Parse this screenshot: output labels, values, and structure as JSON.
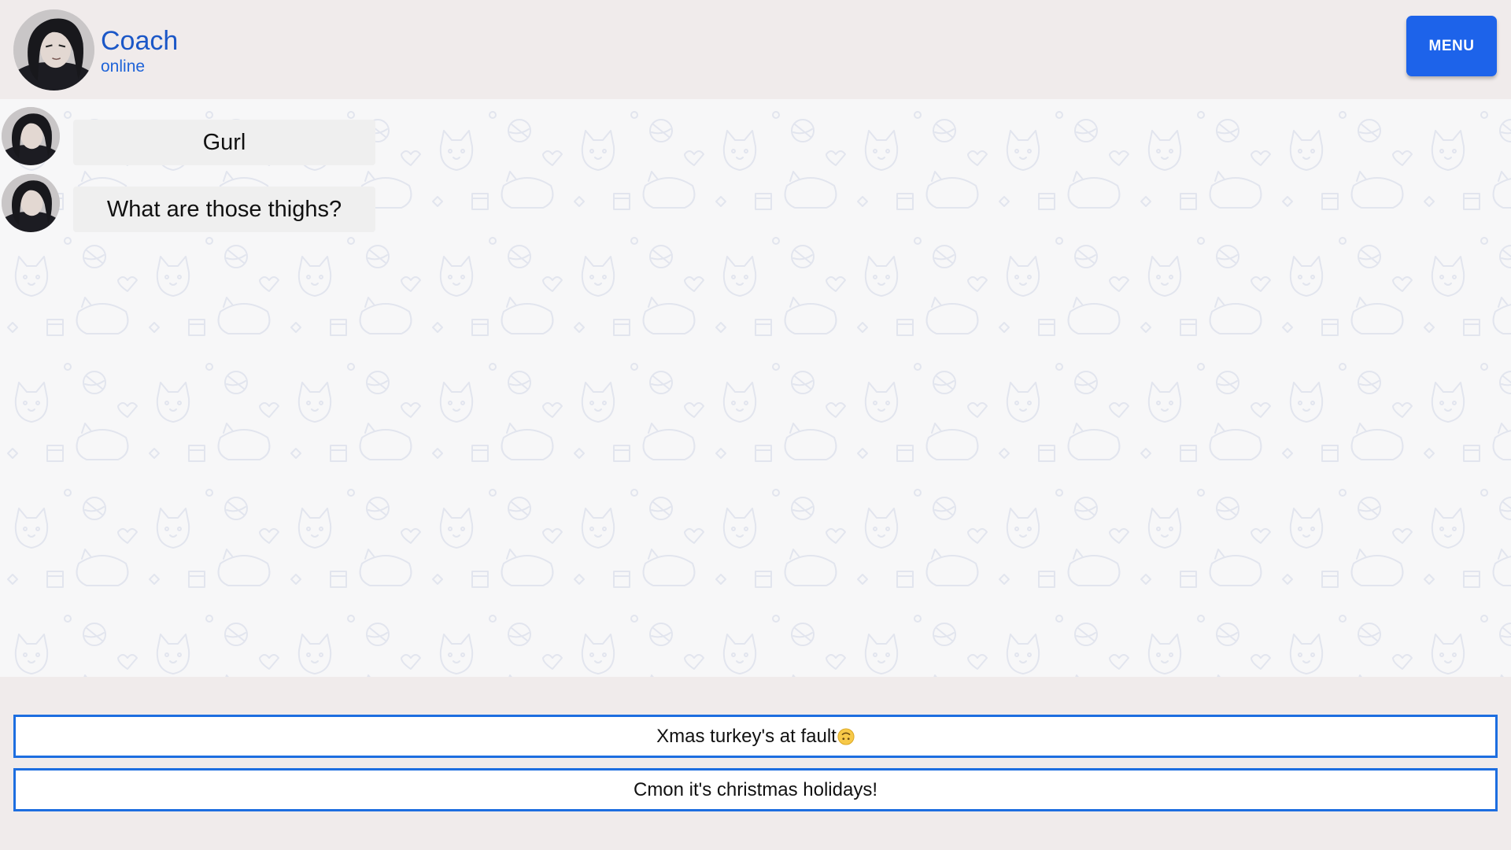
{
  "header": {
    "name": "Coach",
    "status": "online",
    "menu_label": "MENU",
    "avatar_icon": "coach-avatar"
  },
  "messages": [
    {
      "text": "Gurl",
      "avatar_icon": "coach-avatar"
    },
    {
      "text": "What are those thighs?",
      "avatar_icon": "coach-avatar"
    }
  ],
  "choices": [
    {
      "text": "Xmas turkey's at fault",
      "emoji_icon": "upside-down-face-icon"
    },
    {
      "text": "Cmon it's christmas holidays!"
    }
  ],
  "colors": {
    "accent": "#1d63ea",
    "choice_border": "#1d6ee0",
    "name": "#1b57c7",
    "page_bg": "#f0ebeb",
    "chat_bg": "#f7f7f8",
    "bubble_bg": "#efefef"
  }
}
